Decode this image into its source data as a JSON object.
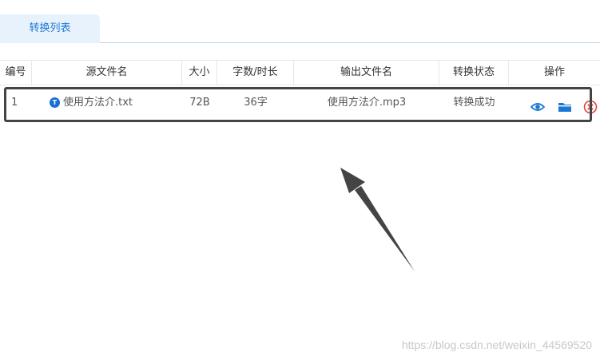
{
  "tabs": [
    {
      "label": "转换列表"
    }
  ],
  "table": {
    "headers": [
      "编号",
      "源文件名",
      "大小",
      "字数/时长",
      "输出文件名",
      "转换状态",
      "操作"
    ],
    "rows": [
      {
        "index": "1",
        "source_badge": "T",
        "source_name": "使用方法介.txt",
        "size": "72B",
        "length": "36字",
        "output_name": "使用方法介.mp3",
        "status": "转换成功"
      }
    ]
  },
  "icons": {
    "preview": "eye-icon",
    "open_folder": "folder-icon",
    "delete": "close-circle-icon"
  },
  "colors": {
    "accent": "#1a78d2",
    "delete": "#e53935",
    "annotation": "#444444"
  },
  "watermark": "https://blog.csdn.net/weixin_44569520"
}
